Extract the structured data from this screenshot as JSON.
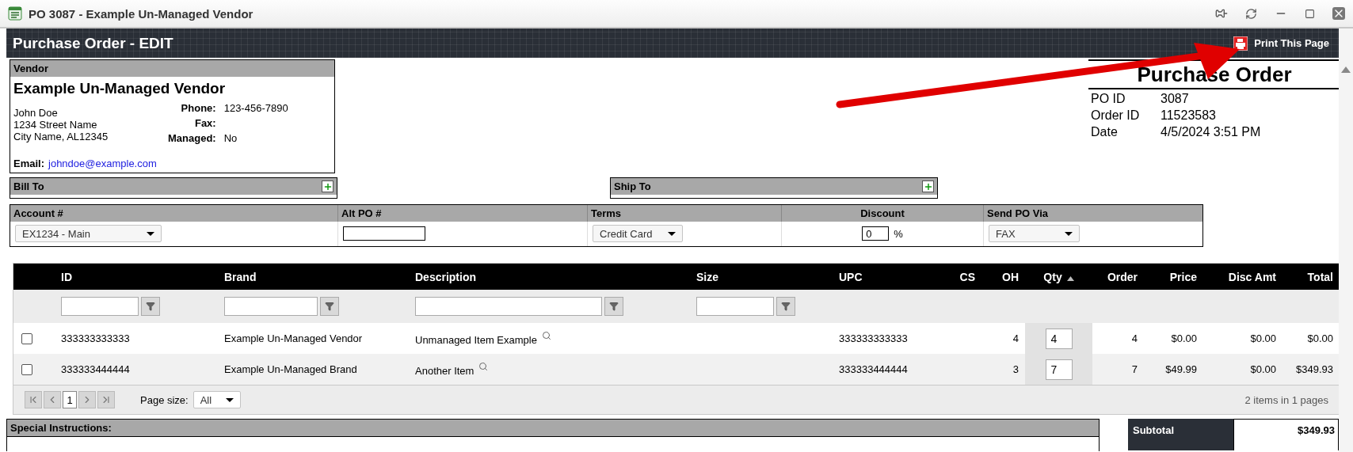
{
  "window": {
    "title": "PO 3087 - Example Un-Managed Vendor"
  },
  "header": {
    "title": "Purchase Order - EDIT",
    "print_label": "Print This Page"
  },
  "vendor": {
    "heading": "Vendor",
    "name": "Example Un-Managed Vendor",
    "address": [
      "John Doe",
      "1234 Street Name",
      "City Name, AL12345"
    ],
    "fields": [
      {
        "label": "Phone:",
        "value": "123-456-7890"
      },
      {
        "label": "Fax:"
      },
      {
        "label": "Managed:",
        "value": "No"
      }
    ],
    "email_label": "Email:",
    "email": "johndoe@example.com"
  },
  "purchase_order": {
    "title": "Purchase Order",
    "fields": [
      {
        "label": "PO ID",
        "value": "3087"
      },
      {
        "label": "Order ID",
        "value": "11523583"
      },
      {
        "label": "Date",
        "value": "4/5/2024 3:51 PM"
      }
    ]
  },
  "bill_to": {
    "label": "Bill To"
  },
  "ship_to": {
    "label": "Ship To"
  },
  "order_settings": {
    "columns": [
      "Account #",
      "Alt PO #",
      "Terms",
      "Discount",
      "Send PO Via"
    ],
    "account": "EX1234 - Main",
    "terms": "Credit Card",
    "discount": "0",
    "discount_unit": "%",
    "send_via": "FAX"
  },
  "grid": {
    "columns": [
      {
        "label": "ID",
        "sorted": false
      },
      {
        "label": "Brand",
        "sorted": false
      },
      {
        "label": "Description",
        "sorted": false
      },
      {
        "label": "Size",
        "sorted": false
      },
      {
        "label": "UPC",
        "sorted": false
      },
      {
        "label": "CS",
        "sorted": false
      },
      {
        "label": "OH",
        "sorted": false
      },
      {
        "label": "Qty",
        "sorted": true
      },
      {
        "label": "Order",
        "sorted": false
      },
      {
        "label": "Price",
        "sorted": false
      },
      {
        "label": "Disc Amt",
        "sorted": false
      },
      {
        "label": "Total",
        "sorted": false
      }
    ],
    "rows": [
      {
        "checked": false,
        "id": "333333333333",
        "brand": "Example Un-Managed Vendor",
        "description": "Unmanaged Item Example",
        "upc": "333333333333",
        "oh": "4",
        "qty": "4",
        "order": "4",
        "price": "$0.00",
        "disc_amt": "$0.00",
        "total": "$0.00"
      },
      {
        "checked": false,
        "id": "333333444444",
        "brand": "Example Un-Managed Brand",
        "description": "Another Item",
        "upc": "333333444444",
        "oh": "3",
        "qty": "7",
        "order": "7",
        "price": "$49.99",
        "disc_amt": "$0.00",
        "total": "$349.93"
      }
    ],
    "pager": {
      "page": "1",
      "page_size_label": "Page size:",
      "page_size": "All",
      "summary": "2 items in 1 pages"
    }
  },
  "special_instructions": {
    "label": "Special Instructions:"
  },
  "subtotal": {
    "label": "Subtotal",
    "value": "$349.93"
  }
}
